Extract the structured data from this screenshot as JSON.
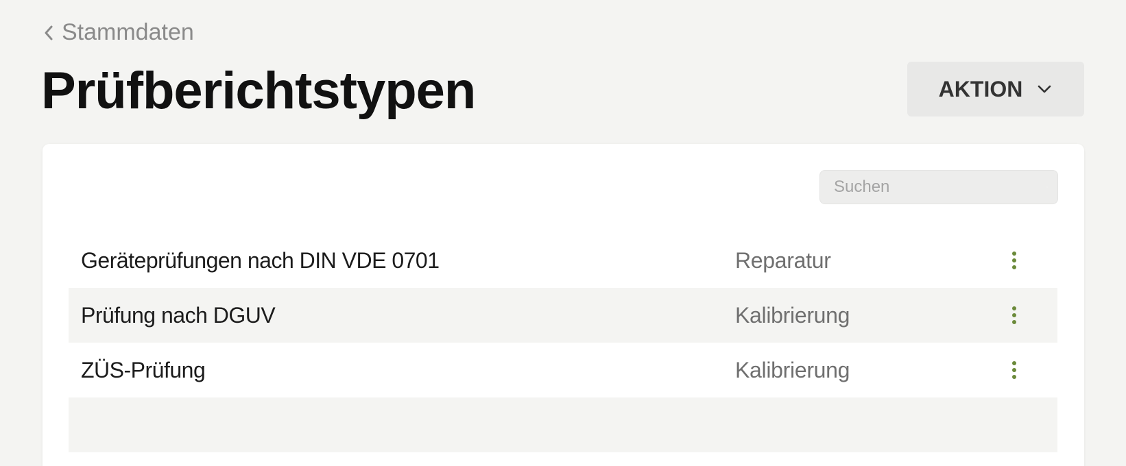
{
  "breadcrumb": {
    "label": "Stammdaten"
  },
  "header": {
    "title": "Prüfberichtstypen",
    "action_label": "AKTION"
  },
  "search": {
    "placeholder": "Suchen",
    "value": ""
  },
  "rows": [
    {
      "name": "Geräteprüfungen nach DIN VDE 0701",
      "type": "Reparatur"
    },
    {
      "name": "Prüfung nach DGUV",
      "type": "Kalibrierung"
    },
    {
      "name": "ZÜS-Prüfung",
      "type": "Kalibrierung"
    }
  ],
  "colors": {
    "menu_dots": "#6b8a3a",
    "background": "#f4f4f2"
  },
  "icons": {
    "breadcrumb": "chevron-left-icon",
    "action": "chevron-down-icon",
    "search": "search-icon",
    "row_menu": "more-vertical-icon"
  }
}
